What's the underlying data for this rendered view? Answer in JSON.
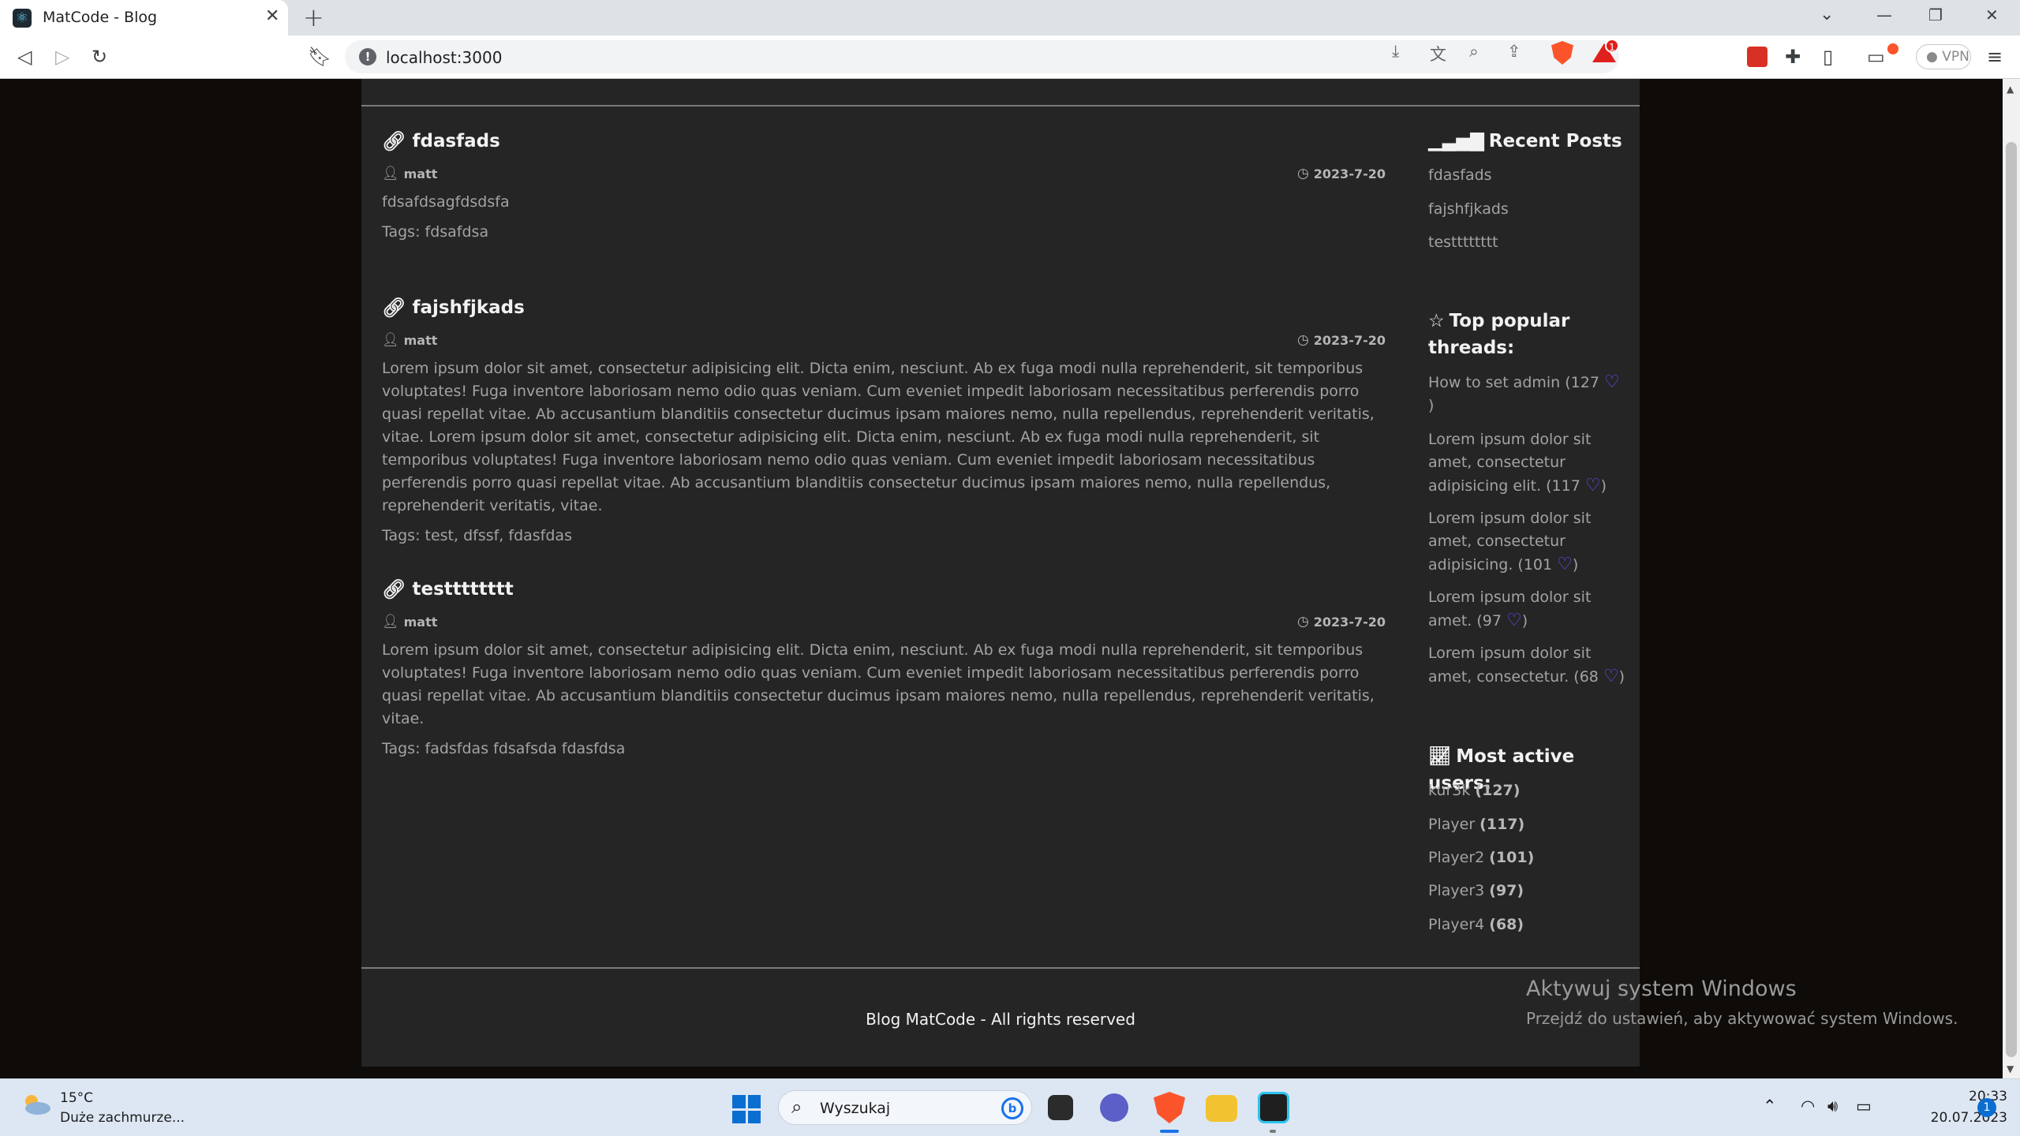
{
  "browser": {
    "tab_title": "MatCode - Blog",
    "tab_close": "✕",
    "new_tab": "+",
    "url": "localhost:3000",
    "rewards_badge": "1",
    "vpn_label": "VPN"
  },
  "posts": [
    {
      "title": "fdasfads",
      "author": "matt",
      "date": "2023-7-20",
      "body": "fdsafdsagfdsdsfa",
      "tags": "Tags: fdsafdsa"
    },
    {
      "title": "fajshfjkads",
      "author": "matt",
      "date": "2023-7-20",
      "body": "Lorem ipsum dolor sit amet, consectetur adipisicing elit. Dicta enim, nesciunt. Ab ex fuga modi nulla reprehenderit, sit temporibus voluptates! Fuga inventore laboriosam nemo odio quas veniam. Cum eveniet impedit laboriosam necessitatibus perferendis porro quasi repellat vitae. Ab accusantium blanditiis consectetur ducimus ipsam maiores nemo, nulla repellendus, reprehenderit veritatis, vitae. Lorem ipsum dolor sit amet, consectetur adipisicing elit. Dicta enim, nesciunt. Ab ex fuga modi nulla reprehenderit, sit temporibus voluptates! Fuga inventore laboriosam nemo odio quas veniam. Cum eveniet impedit laboriosam necessitatibus perferendis porro quasi repellat vitae. Ab accusantium blanditiis consectetur ducimus ipsam maiores nemo, nulla repellendus, reprehenderit veritatis, vitae.",
      "tags": "Tags: test, dfssf, fdasfdas"
    },
    {
      "title": "testttttttt",
      "author": "matt",
      "date": "2023-7-20",
      "body": "Lorem ipsum dolor sit amet, consectetur adipisicing elit. Dicta enim, nesciunt. Ab ex fuga modi nulla reprehenderit, sit temporibus voluptates! Fuga inventore laboriosam nemo odio quas veniam. Cum eveniet impedit laboriosam necessitatibus perferendis porro quasi repellat vitae. Ab accusantium blanditiis consectetur ducimus ipsam maiores nemo, nulla repellendus, reprehenderit veritatis, vitae.",
      "tags": "Tags: fadsfdas fdsafsda fdasfdsa"
    }
  ],
  "sidebar": {
    "recent_title": "Recent Posts",
    "recent": [
      "fdasfads",
      "fajshfjkads",
      "testttttttt"
    ],
    "popular_title_1": "Top popular",
    "popular_title_2": "threads:",
    "popular": [
      {
        "l1": "How to set admin (127",
        "l2": "",
        "l3": "",
        "tail": ")"
      },
      {
        "l1": "Lorem ipsum dolor sit",
        "l2": "amet, consectetur",
        "l3": "adipisicing elit. (117",
        "tail": ")"
      },
      {
        "l1": "Lorem ipsum dolor sit",
        "l2": "amet, consectetur",
        "l3": "adipisicing. (101",
        "tail": ")"
      },
      {
        "l1": "Lorem ipsum dolor sit",
        "l2": "amet. (97",
        "l3": "",
        "tail": ")"
      },
      {
        "l1": "Lorem ipsum dolor sit",
        "l2": "amet, consectetur. (68",
        "l3": "",
        "tail": ")"
      }
    ],
    "active_title": "Most active users:",
    "active": [
      {
        "name": "kur3k",
        "count": "(127)"
      },
      {
        "name": "Player",
        "count": "(117)"
      },
      {
        "name": "Player2",
        "count": "(101)"
      },
      {
        "name": "Player3",
        "count": "(97)"
      },
      {
        "name": "Player4",
        "count": "(68)"
      }
    ]
  },
  "footer": {
    "text": "Blog MatCode - All rights reserved"
  },
  "watermark": {
    "title": "Aktywuj system Windows",
    "subtitle": "Przejdź do ustawień, aby aktywować system Windows."
  },
  "taskbar": {
    "temp": "15°C",
    "weather": "Duże zachmurze...",
    "search_placeholder": "Wyszukaj",
    "time": "20:33",
    "date": "20.07.2023",
    "notifications": "1"
  },
  "colors": {
    "page_bg": "#0e0b08",
    "container_bg": "#252525",
    "heart": "#6f4cff",
    "brave": "#fb542b"
  }
}
